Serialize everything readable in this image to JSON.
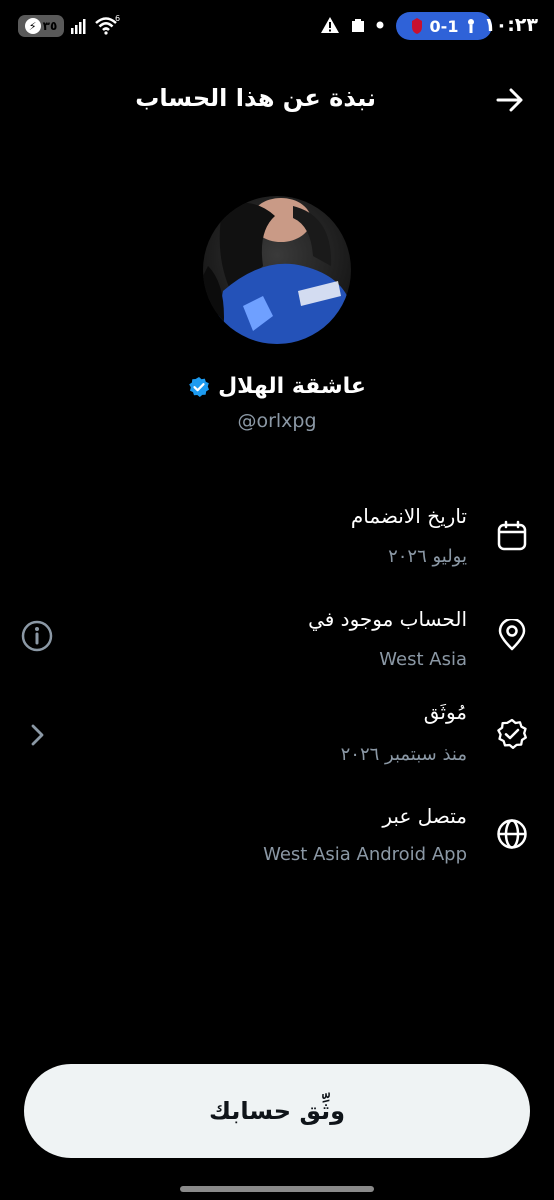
{
  "status_bar": {
    "time": "١٠:٢٣",
    "score": "0-1",
    "battery": "٣٥",
    "network": "6"
  },
  "header": {
    "title": "نبذة عن هذا الحساب"
  },
  "profile": {
    "display_name": "عاشقة الهلال",
    "handle": "@orlxpg"
  },
  "info": {
    "joined_title": "تاريخ الانضمام",
    "joined_value": "يوليو ٢٠٢٦",
    "location_title": "الحساب موجود في",
    "location_value": "West Asia",
    "verified_title": "مُوثَق",
    "verified_value": "منذ سبتمبر ٢٠٢٦",
    "connected_title": "متصل عبر",
    "connected_value": "West Asia Android App"
  },
  "verify_button": "وثِّق حسابك",
  "colors": {
    "background": "#000000",
    "text_secondary": "#8b98a5",
    "verified_blue": "#1d9bf0",
    "button_bg": "#eff3f4"
  }
}
